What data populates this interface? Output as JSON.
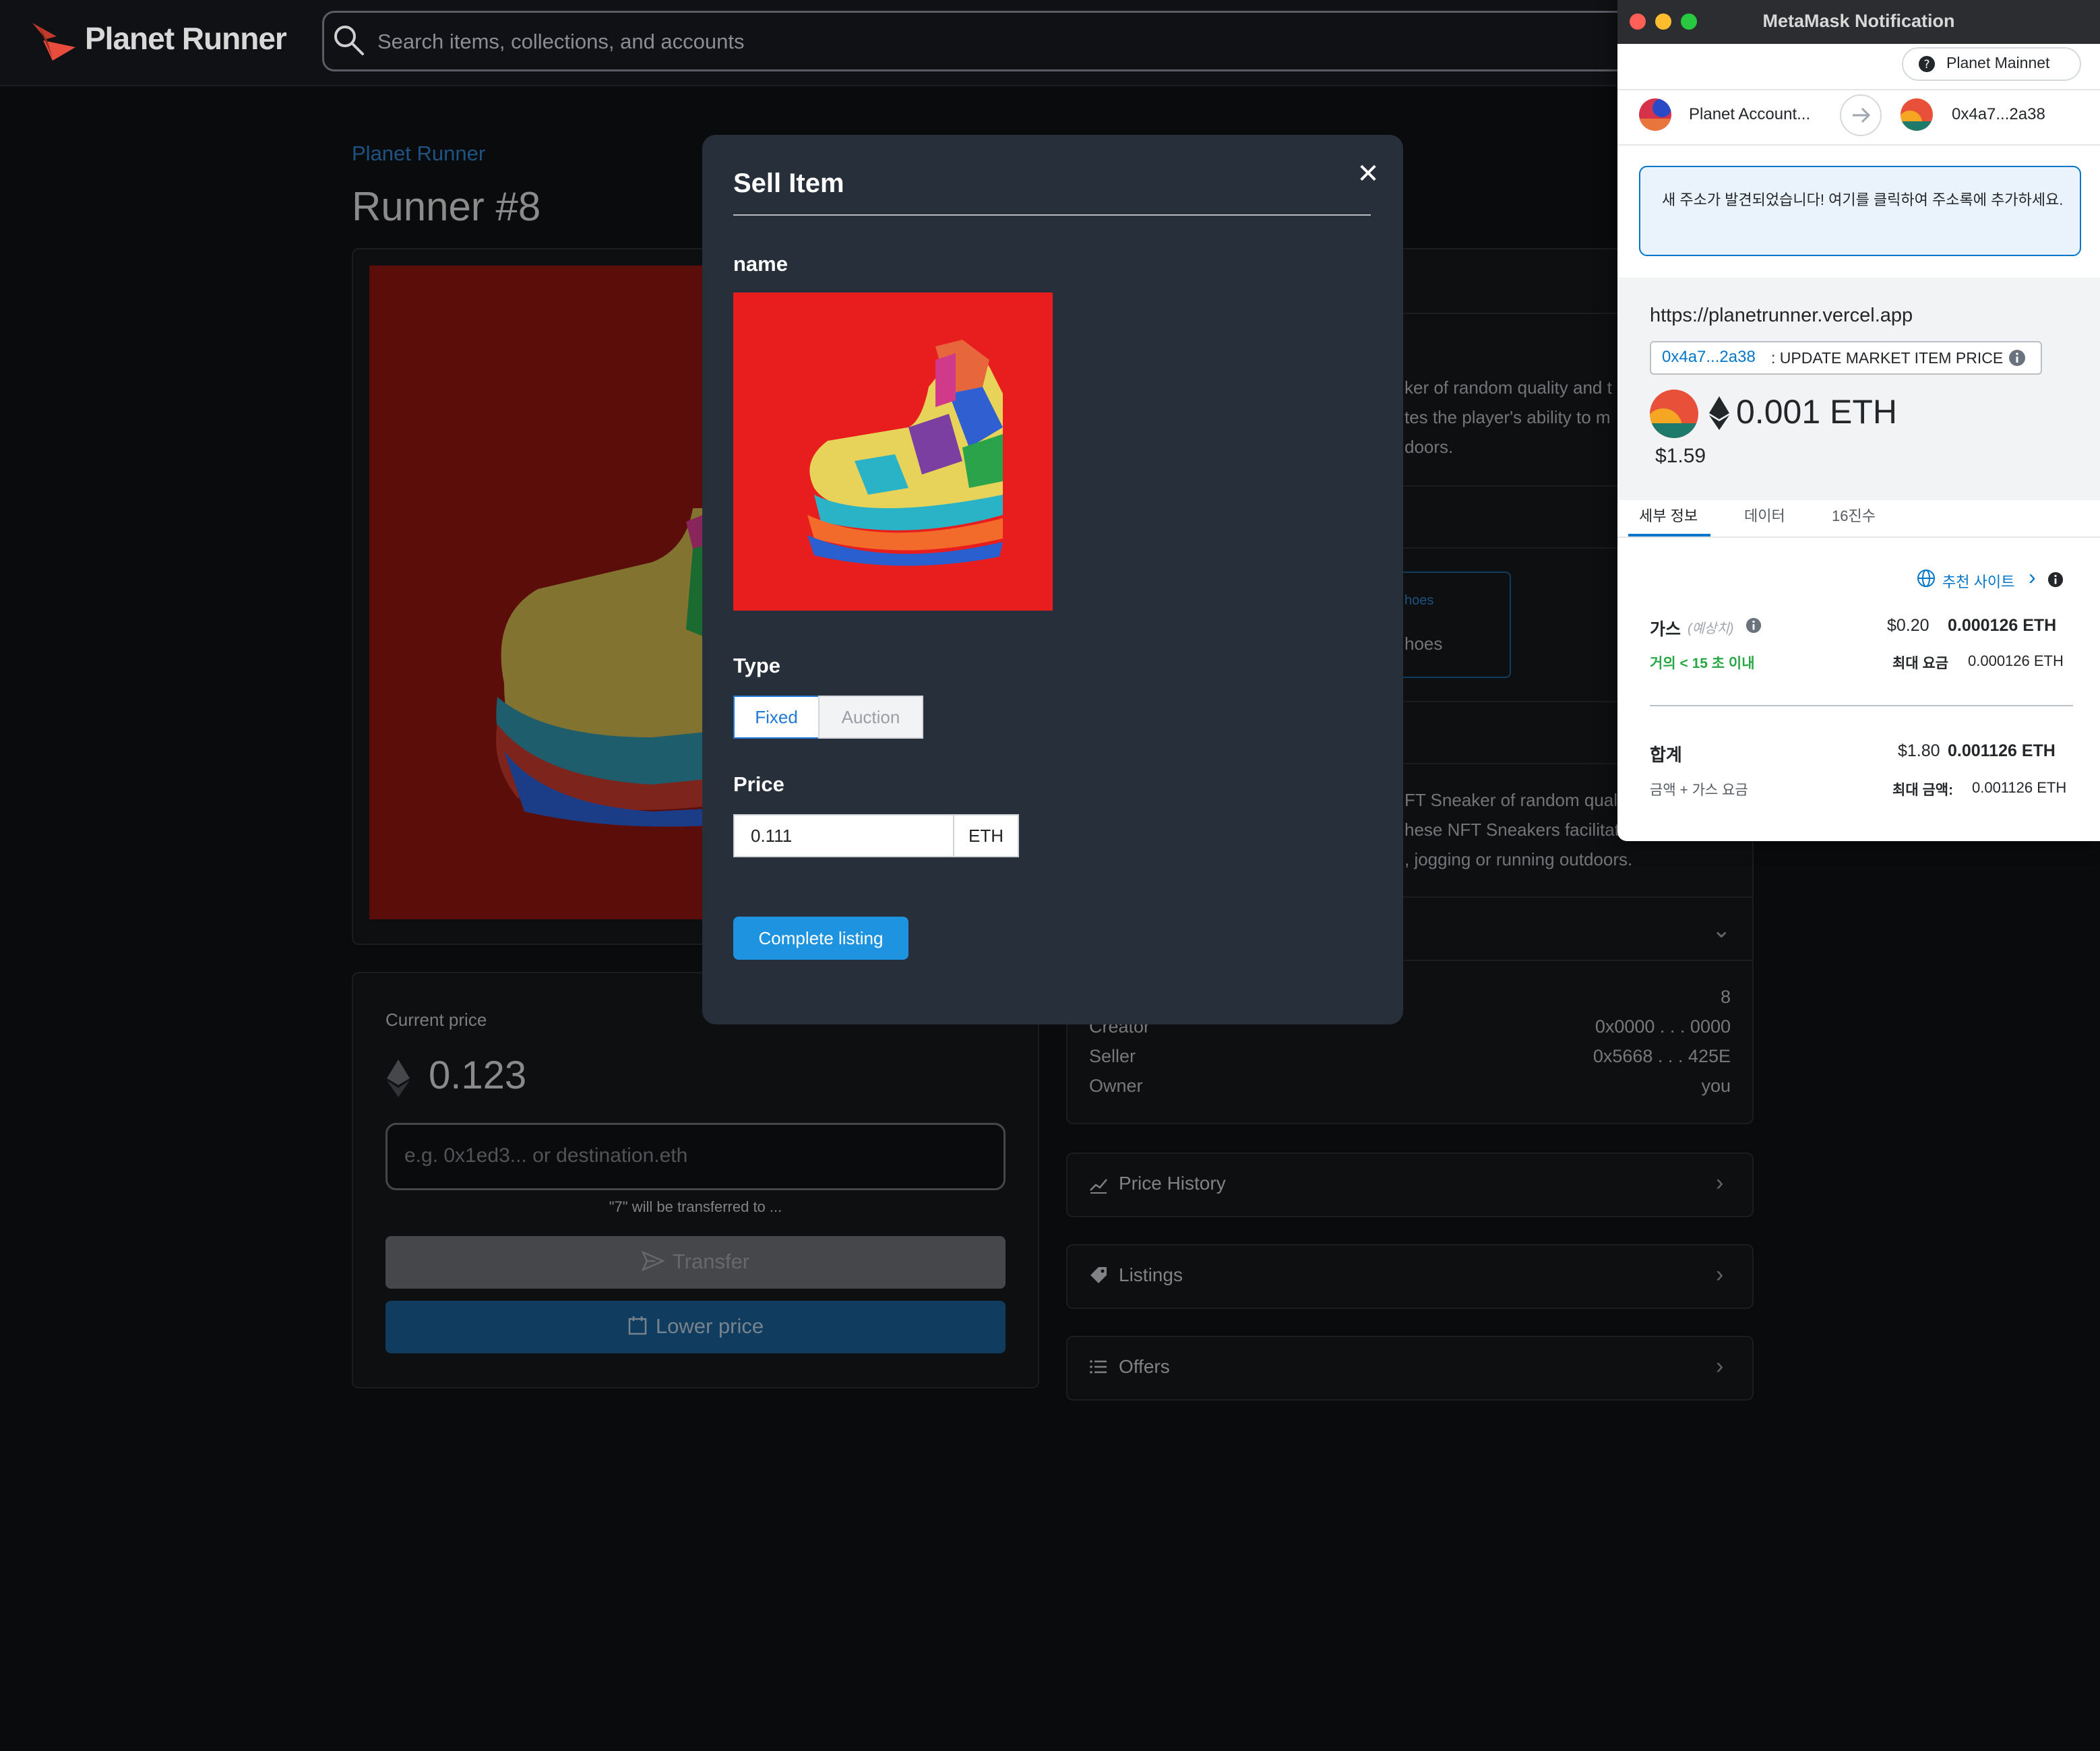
{
  "app": {
    "name": "Planet Runner",
    "search_placeholder": "Search items, collections, and accounts"
  },
  "item": {
    "collection": "Planet Runner",
    "title": "Runner #8",
    "description_lines": [
      "ker of random quality and t",
      "tes the player's ability to m",
      "doors."
    ],
    "collection_card_small": "hoes",
    "collection_card": "hoes",
    "about_lines": [
      "FT Sneaker of random qual",
      "hese NFT Sneakers facilitat",
      ", jogging or running outdoors."
    ],
    "details": [
      {
        "label": "",
        "value": "8"
      },
      {
        "label": "Creator",
        "value": "0x0000 . . . 0000"
      },
      {
        "label": "Seller",
        "value": "0x5668 . . . 425E"
      },
      {
        "label": "Owner",
        "value": "you"
      }
    ]
  },
  "price_panel": {
    "current_price_label": "Current price",
    "price": "0.123",
    "address_placeholder": "e.g. 0x1ed3... or destination.eth",
    "transfer_hint": "\"7\" will be transferred to ...",
    "transfer_label": "Transfer",
    "lower_price_label": "Lower price"
  },
  "accordions": [
    {
      "label": "Price History",
      "icon": "chart-line-icon"
    },
    {
      "label": "Listings",
      "icon": "tag-icon"
    },
    {
      "label": "Offers",
      "icon": "list-icon"
    }
  ],
  "modal": {
    "title": "Sell Item",
    "close": "✕",
    "name_label": "name",
    "type_label": "Type",
    "type_options": [
      "Fixed",
      "Auction"
    ],
    "type_selected": "Fixed",
    "price_label": "Price",
    "price_value": "0.111",
    "price_unit": "ETH",
    "submit_label": "Complete listing"
  },
  "metamask": {
    "window_title": "MetaMask Notification",
    "network": "Planet Mainnet",
    "from_account": "Planet Account...",
    "to_account": "0x4a7...2a38",
    "alert": "새 주소가 발견되었습니다! 여기를 클릭하여 주소록에 추가하세요.",
    "origin": "https://planetrunner.vercel.app",
    "contract_addr": "0x4a7...2a38",
    "method": ": UPDATE MARKET ITEM PRICE",
    "amount": "0.001 ETH",
    "amount_usd": "$1.59",
    "tabs": [
      "세부 정보",
      "데이터",
      "16진수"
    ],
    "active_tab": "세부 정보",
    "suggested_site": "추천 사이트",
    "gas_label": "가스",
    "gas_estimated": "(예상치)",
    "gas_usd": "$0.20",
    "gas_eth": "0.000126 ETH",
    "gas_speed": "거의 < 15 초 이내",
    "max_fee_label": "최대 요금",
    "max_fee": "0.000126 ETH",
    "total_label": "합계",
    "total_usd": "$1.80",
    "total_eth": "0.001126 ETH",
    "total_sub": "금액 + 가스 요금",
    "max_amount_label": "최대 금액:",
    "max_amount": "0.001126 ETH",
    "colors": {
      "accent": "#0376c9",
      "success": "#28a745"
    }
  }
}
